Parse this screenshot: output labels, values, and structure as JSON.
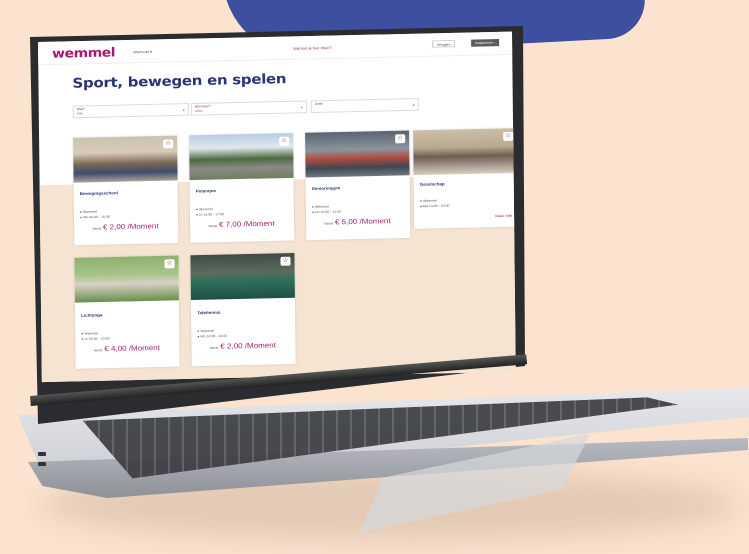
{
  "app": {
    "logo": "wemmel",
    "nav_select": "Wemmel ▾",
    "nav_link": "Wat kan ik hier doen?",
    "btn_login": "Inloggen",
    "btn_register": "Registreren ›"
  },
  "page": {
    "heading": "Sport, bewegen en spelen"
  },
  "filters": [
    {
      "label": "Wat?",
      "value": "Alle",
      "caret": "▾"
    },
    {
      "label": "Wanneer?",
      "value": "Altijd",
      "caret": "▾"
    },
    {
      "label": "Zoek",
      "value": "",
      "caret": "▾"
    }
  ],
  "cards": [
    {
      "title": "Bewegingsschool",
      "loc": "Wemmel",
      "time": "Wo 09:30 - 10:30",
      "price_prefix": "Vanaf",
      "price": "€ 2,00 /Moment"
    },
    {
      "title": "Petanque",
      "loc": "Wemmel",
      "time": "Di 14:00 - 17:00",
      "price_prefix": "Vanaf",
      "price": "€ 7,00 /Moment"
    },
    {
      "title": "Seniorengym",
      "loc": "Wemmel",
      "time": "Do 10:00 - 11:00",
      "price_prefix": "Vanaf",
      "price": "€ 5,00 /Moment"
    },
    {
      "title": "Gezelschap",
      "loc": "Wemmel",
      "time": "Ma 14:00 - 16:00",
      "price_prefix": "",
      "price": "",
      "more": "Meer info"
    },
    {
      "title": "Lichtyoga",
      "loc": "Wemmel",
      "time": "Vr 09:30 - 10:30",
      "price_prefix": "Vanaf",
      "price": "€ 4,00 /Moment"
    },
    {
      "title": "Tafeltennis",
      "loc": "Wemmel",
      "time": "Wo 14:00 - 16:00",
      "price_prefix": "Vanaf",
      "price": "€ 2,00 /Moment"
    }
  ],
  "icons": {
    "fav": "star-icon"
  },
  "colors": {
    "brand": "#a51b73",
    "heading": "#2a3577",
    "blob": "#3d4f9e",
    "background": "#fbe3cf"
  }
}
